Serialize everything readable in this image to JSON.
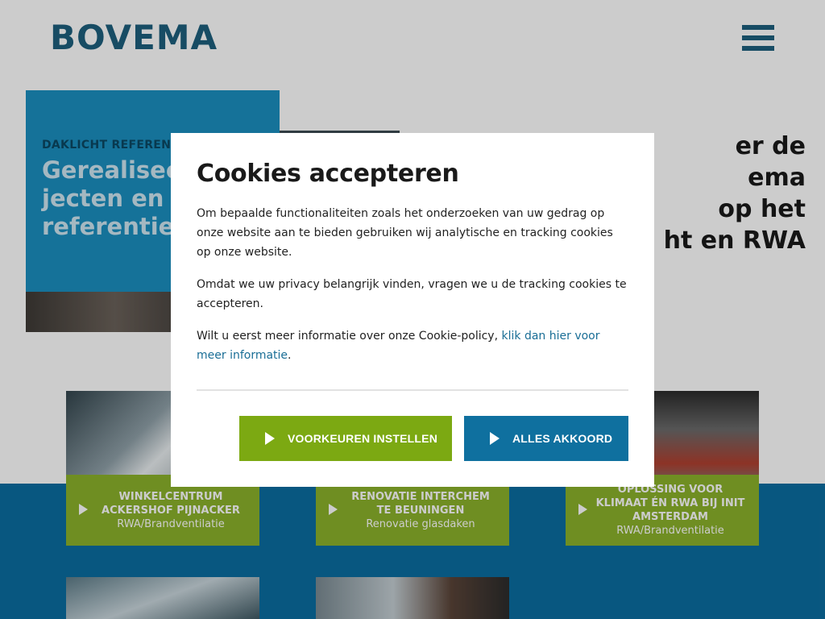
{
  "header": {
    "logo_text": "BOVEMA",
    "menu_icon": "hamburger-menu-icon"
  },
  "hero": {
    "kicker": "DAKLICHT REFERENT",
    "title_lines": [
      "Gerealiseer",
      "jecten en",
      "referenties"
    ],
    "text_lines": [
      "er de",
      "ema",
      "op het",
      "ht en RWA"
    ]
  },
  "references": [
    {
      "title_lines": [
        "WINKELCENTRUM",
        "ACKERSHOF PIJNACKER"
      ],
      "subtitle": "RWA/Brandventilatie"
    },
    {
      "title_lines": [
        "RENOVATIE INTERCHEM",
        "TE BEUNINGEN"
      ],
      "subtitle": "Renovatie glasdaken"
    },
    {
      "title_lines": [
        "OPLOSSING VOOR",
        "KLIMAAT ÉN RWA BIJ INIT",
        "AMSTERDAM"
      ],
      "subtitle": "RWA/Brandventilatie"
    }
  ],
  "cookie_modal": {
    "title": "Cookies accepteren",
    "paragraph1": "Om bepaalde functionaliteiten zoals het onderzoeken van uw gedrag op onze website aan te bieden gebruiken wij analytische en tracking cookies op onze website.",
    "paragraph2": "Omdat we uw privacy belangrijk vinden, vragen we u de tracking cookies te accepteren.",
    "paragraph3_prefix": "Wilt u eerst meer informatie over onze Cookie-policy, ",
    "paragraph3_link": "klik dan hier voor meer informatie",
    "paragraph3_suffix": ".",
    "preferences_button": "VOORKEUREN INSTELLEN",
    "accept_button": "ALLES AKKOORD"
  },
  "colors": {
    "brand_blue": "#1d5f7d",
    "button_green": "#7ca912",
    "button_blue": "#0f709f",
    "card_green": "#8bb22b"
  }
}
